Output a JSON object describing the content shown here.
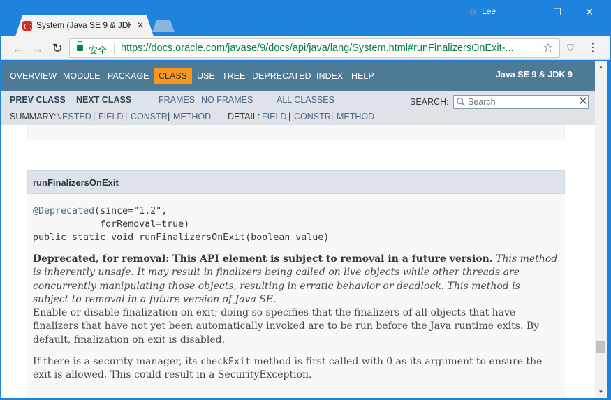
{
  "browser": {
    "tab_title": "System (Java SE 9 & JDK",
    "user": "Lee",
    "secure_label": "安全",
    "url": "https://docs.oracle.com/javase/9/docs/api/java/lang/System.html#runFinalizersOnExit-..."
  },
  "nav": {
    "items": [
      "OVERVIEW",
      "MODULE",
      "PACKAGE",
      "CLASS",
      "USE",
      "TREE",
      "DEPRECATED",
      "INDEX",
      "HELP"
    ],
    "active": "CLASS",
    "brand": "Java SE 9 & JDK 9"
  },
  "subnav": {
    "prev_class": "PREV CLASS",
    "next_class": "NEXT CLASS",
    "frames": "FRAMES",
    "no_frames": "NO FRAMES",
    "all_classes": "ALL CLASSES",
    "search_label": "SEARCH:",
    "search_placeholder": "Search",
    "summary_label": "SUMMARY:",
    "summary_links": [
      "NESTED",
      "FIELD",
      "CONSTR",
      "METHOD"
    ],
    "detail_label": "DETAIL:",
    "detail_links": [
      "FIELD",
      "CONSTR",
      "METHOD"
    ],
    "divider": "|"
  },
  "method": {
    "name": "runFinalizersOnExit",
    "annotation": "@Deprecated",
    "since_line": "(since=\"1.2\",",
    "removal_line": "            forRemoval=true)",
    "signature": "public static void runFinalizersOnExit(boolean value)",
    "deprecated_bold": "Deprecated, for removal: This API element is subject to removal in a future version.",
    "deprecated_italic": "This method is inherently unsafe. It may result in finalizers being called on live objects while other threads are concurrently manipulating those objects, resulting in erratic behavior or deadlock. This method is subject to removal in a future version of Java SE.",
    "paragraph1": "Enable or disable finalization on exit; doing so specifies that the finalizers of all objects that have finalizers that have not yet been automatically invoked are to be run before the Java runtime exits. By default, finalization on exit is disabled.",
    "paragraph2_a": "If there is a security manager, its ",
    "paragraph2_code": "checkExit",
    "paragraph2_b": " method is first called with 0 as its argument to ensure the exit is allowed. This could result in a SecurityException."
  },
  "colors": {
    "nav_bg": "#4d7a97",
    "nav_active": "#f8981d",
    "subnav_bg": "#dee3e9",
    "chrome": "#1e83dd"
  }
}
